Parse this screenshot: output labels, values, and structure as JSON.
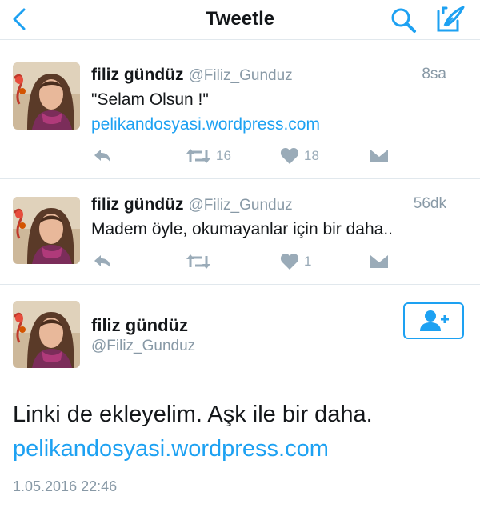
{
  "header": {
    "title": "Tweetle",
    "back_icon": "chevron-left-icon",
    "search_icon": "search-icon",
    "compose_icon": "compose-icon",
    "accent": "#1da1f2"
  },
  "tweets": [
    {
      "name": "filiz gündüz",
      "handle": "@Filiz_Gunduz",
      "time": "8sa",
      "text": "\"Selam Olsun !\"",
      "link": "pelikandosyasi.wordpress.com",
      "retweets": "16",
      "likes": "18"
    },
    {
      "name": "filiz gündüz",
      "handle": "@Filiz_Gunduz",
      "time": "56dk",
      "text": "Madem öyle, okumayanlar için bir daha..",
      "retweets": "",
      "likes": "1"
    }
  ],
  "detail": {
    "name": "filiz gündüz",
    "handle": "@Filiz_Gunduz",
    "text": "Linki de ekleyelim. Aşk ile bir daha.",
    "link": "pelikandosyasi.wordpress.com",
    "date": "1.05.2016 22:46",
    "follow_icon": "add-user-icon"
  }
}
